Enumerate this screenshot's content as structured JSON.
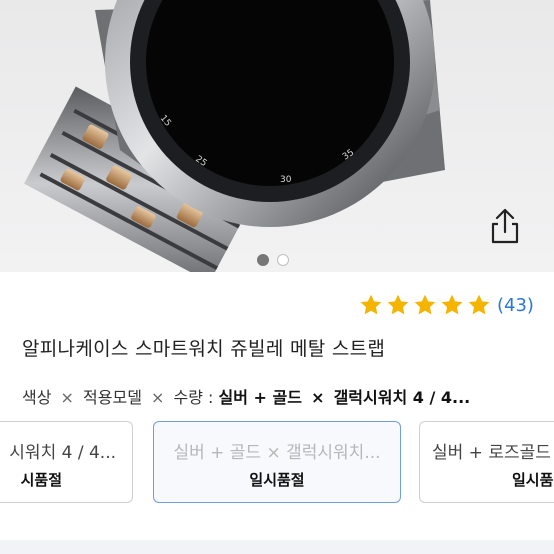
{
  "product_image": {
    "gallery_dots": [
      true,
      false
    ]
  },
  "share_icon": "share-icon",
  "rating": {
    "stars": 5,
    "star_color": "#f4b400",
    "review_count": "(43)"
  },
  "title": "알피나케이스 스마트워치 쥬빌레 메탈 스트랩",
  "option_summary": {
    "labels": [
      "색상",
      "적용모델",
      "수량 :"
    ],
    "separator": "×",
    "values": [
      "실버 + 골드",
      "갤럭시워치 4 / 4..."
    ],
    "value_separator": "×"
  },
  "options": [
    {
      "name": "시워치 4 / 4...",
      "status": "시품절"
    },
    {
      "name": "실버 + 골드 × 갤럭시워치...",
      "status": "일시품절",
      "selected": true
    },
    {
      "name": "실버 + 로즈골드",
      "status": "일시품절"
    }
  ],
  "colors": {
    "link_blue": "#2878d7",
    "selected_border": "#6f9fdf"
  }
}
